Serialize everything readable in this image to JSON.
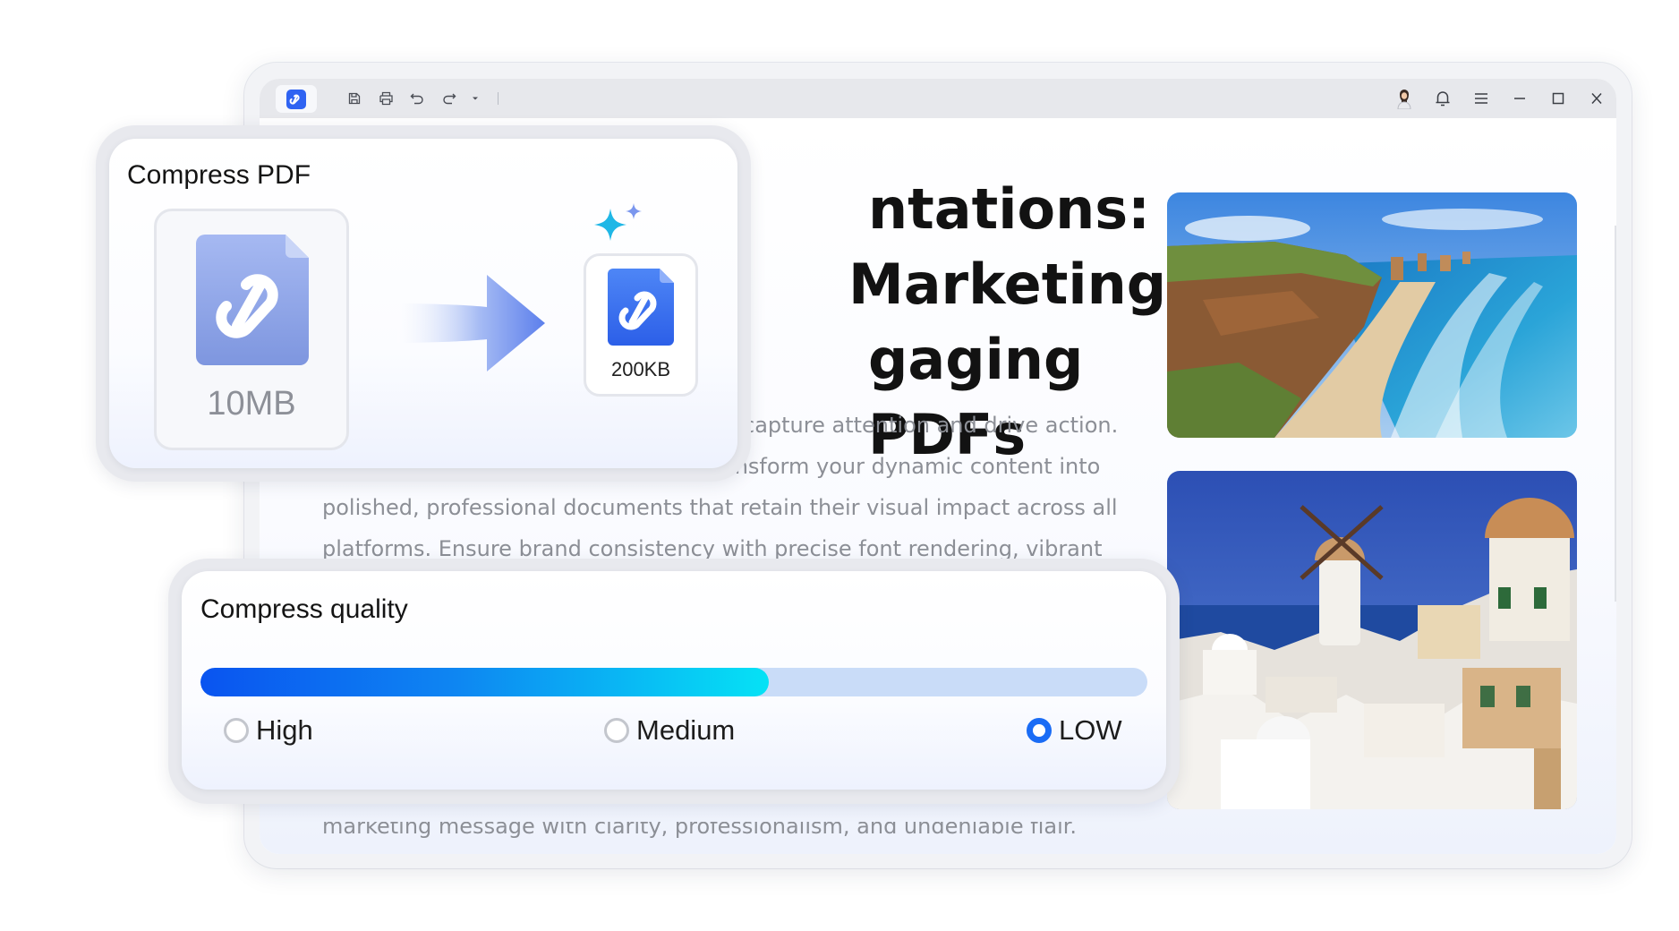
{
  "document": {
    "title_lines": [
      "ntations:",
      " Marketing",
      "gaging PDFs"
    ],
    "paragraph_lines": [
      "capture attention and drive action.",
      "ansform your dynamic content into",
      "polished, professional documents that retain their visual impact across all",
      "platforms. Ensure brand consistency with precise font rendering, vibrant"
    ],
    "paragraph_tail": "marketing message with clarity, professionalism, and undeniable flair."
  },
  "compress_pdf": {
    "title": "Compress PDF",
    "original_size": "10MB",
    "compressed_size": "200KB"
  },
  "compress_quality": {
    "title": "Compress quality",
    "level": 0.6,
    "options": [
      {
        "label": "High",
        "selected": false
      },
      {
        "label": "Medium",
        "selected": false
      },
      {
        "label": "LOW",
        "selected": true
      }
    ]
  },
  "toolbar": {
    "left_icons": [
      "save-icon",
      "print-icon",
      "undo-icon",
      "redo-icon",
      "dropdown-icon"
    ],
    "right_icons": [
      "avatar",
      "bell-icon",
      "menu-icon",
      "minimize-icon",
      "maximize-icon",
      "close-icon"
    ]
  },
  "colors": {
    "accent": "#1a6cf5",
    "slider_start": "#0a54f0",
    "slider_end": "#05e2f5",
    "slider_track": "#c9dcf8"
  }
}
